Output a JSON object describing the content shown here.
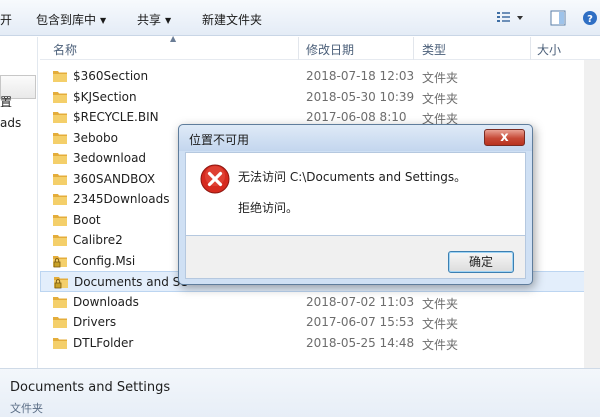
{
  "toolbar": {
    "open_partial": "开",
    "include_library": "包含到库中",
    "share": "共享",
    "new_folder": "新建文件夹"
  },
  "nav": {
    "label_1": "置",
    "label_2": "ads"
  },
  "columns": {
    "name": "名称",
    "date": "修改日期",
    "type": "类型",
    "size": "大小"
  },
  "files": [
    {
      "name": "$360Section",
      "date": "2018-07-18 12:03",
      "type": "文件夹"
    },
    {
      "name": "$KJSection",
      "date": "2018-05-30 10:39",
      "type": "文件夹"
    },
    {
      "name": "$RECYCLE.BIN",
      "date": "2017-06-08 8:10",
      "type": "文件夹"
    },
    {
      "name": "3ebobo",
      "date": "",
      "type": ""
    },
    {
      "name": "3edownload",
      "date": "",
      "type": ""
    },
    {
      "name": "360SANDBOX",
      "date": "",
      "type": ""
    },
    {
      "name": "2345Downloads",
      "date": "",
      "type": ""
    },
    {
      "name": "Boot",
      "date": "",
      "type": ""
    },
    {
      "name": "Calibre2",
      "date": "",
      "type": ""
    },
    {
      "name": "Config.Msi",
      "date": "",
      "type": ""
    },
    {
      "name": "Documents and Se",
      "date": "",
      "type": ""
    },
    {
      "name": "Downloads",
      "date": "2018-07-02 11:03",
      "type": "文件夹"
    },
    {
      "name": "Drivers",
      "date": "2017-06-07 15:53",
      "type": "文件夹"
    },
    {
      "name": "DTLFolder",
      "date": "2018-05-25 14:48",
      "type": "文件夹"
    }
  ],
  "details": {
    "name": "Documents and Settings",
    "type": "文件夹"
  },
  "dialog": {
    "title": "位置不可用",
    "close_label": "x",
    "message_line1": "无法访问 C:\\Documents and Settings。",
    "message_line2": "拒绝访问。",
    "ok_label": "确定"
  },
  "icons": {
    "folder": "folder-icon",
    "locked_folder": "locked-folder-icon",
    "error": "error-icon",
    "view": "view-options-icon",
    "preview": "preview-pane-icon",
    "help": "help-icon"
  },
  "colors": {
    "folder": "#f2c14e",
    "error_red": "#d62a1f",
    "dialog_frame": "#cfe0f4",
    "selection": "#e3eefb"
  }
}
